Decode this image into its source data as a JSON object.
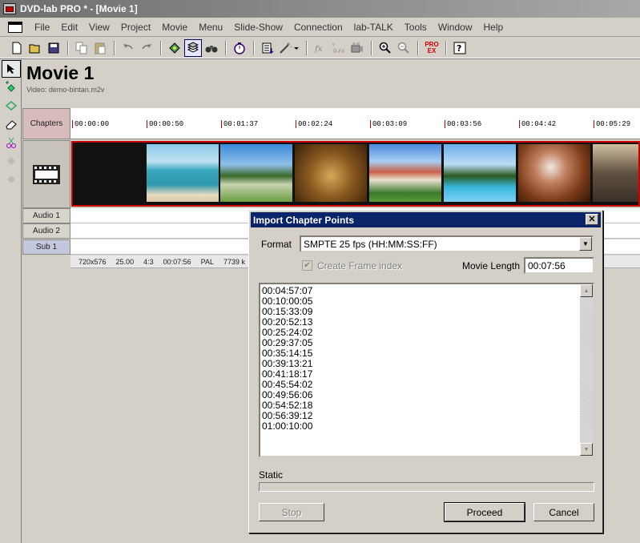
{
  "window": {
    "title": "DVD-lab PRO * - [Movie 1]"
  },
  "menu": [
    "File",
    "Edit",
    "View",
    "Project",
    "Movie",
    "Menu",
    "Slide-Show",
    "Connection",
    "lab-TALK",
    "Tools",
    "Window",
    "Help"
  ],
  "toolbar": {
    "icons": [
      "new-icon",
      "open-icon",
      "save-icon",
      "copy-icon",
      "paste-icon",
      "undo-icon",
      "redo-icon",
      "assets-icon",
      "layers-icon",
      "binoculars-icon",
      "timer-icon",
      "list-icon",
      "magic-wand-icon",
      "fx-icon",
      "dfx-icon",
      "movie-render-icon",
      "zoom-in-icon",
      "zoom-out-icon",
      "pro-ex-icon",
      "help-icon"
    ],
    "pro_ex_label": "PRO EX"
  },
  "movie": {
    "title": "Movie 1",
    "video_file": "Video: demo-bintan.m2v"
  },
  "tracks": {
    "chapters": "Chapters",
    "audio1": "Audio 1",
    "audio2": "Audio 2",
    "sub1": "Sub 1"
  },
  "ruler_ticks": [
    "00:00:00",
    "00:00:50",
    "00:01:37",
    "00:02:24",
    "00:03:09",
    "00:03:56",
    "00:04:42",
    "00:05:29"
  ],
  "info": {
    "resolution": "720x576",
    "fps": "25.00",
    "aspect": "4:3",
    "duration": "00:07:56",
    "standard": "PAL",
    "bitrate": "7739 k"
  },
  "dialog": {
    "title": "Import Chapter Points",
    "format_label": "Format",
    "format_value": "SMPTE 25 fps (HH:MM:SS:FF)",
    "create_frame_index_label": "Create Frame index",
    "movie_length_label": "Movie Length",
    "movie_length_value": "00:07:56",
    "chapter_points": [
      "00:04:57:07",
      "00:10:00:05",
      "00:15:33:09",
      "00:20:52:13",
      "00:25:24:02",
      "00:29:37:05",
      "00:35:14:15",
      "00:39:13:21",
      "00:41:18:17",
      "00:45:54:02",
      "00:49:56:06",
      "00:54:52:18",
      "00:56:39:12",
      "01:00:10:00"
    ],
    "status_label": "Static",
    "progress": 0,
    "stop_label": "Stop",
    "proceed_label": "Proceed",
    "cancel_label": "Cancel"
  },
  "colors": {
    "dialog_title_bg": "#0a246a",
    "timeline_marker": "#cc0000",
    "chapters_track": "#d8bcbc"
  }
}
